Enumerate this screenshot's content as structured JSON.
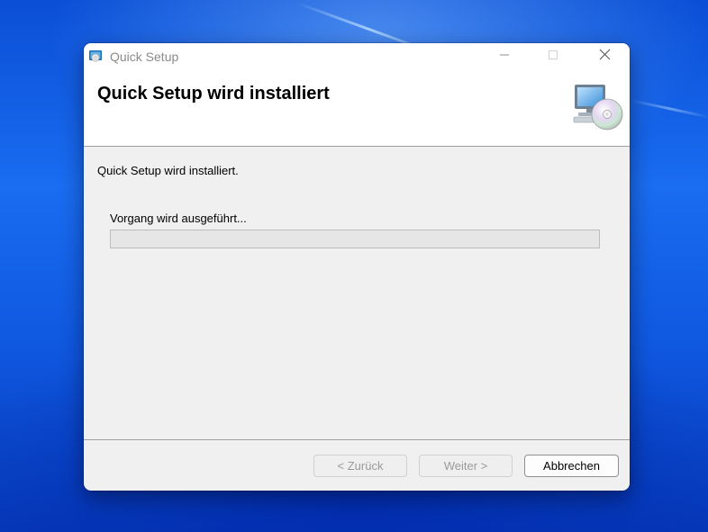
{
  "window": {
    "title": "Quick Setup",
    "controls": {
      "minimize": "minimize-icon",
      "maximize": "maximize-icon",
      "close": "close-icon"
    }
  },
  "header": {
    "title": "Quick Setup wird installiert",
    "icon": "computer-disc-icon"
  },
  "body": {
    "status_text": "Quick Setup wird installiert.",
    "progress_label": "Vorgang wird ausgeführt...",
    "progress_value": 0
  },
  "buttons": {
    "back_label": "< Zurück",
    "next_label": "Weiter >",
    "cancel_label": "Abbrechen"
  },
  "colors": {
    "desktop_blue": "#1a6cf0",
    "dialog_background": "#f0f0f0",
    "header_background": "#ffffff",
    "progress_fill": "#06b025"
  }
}
